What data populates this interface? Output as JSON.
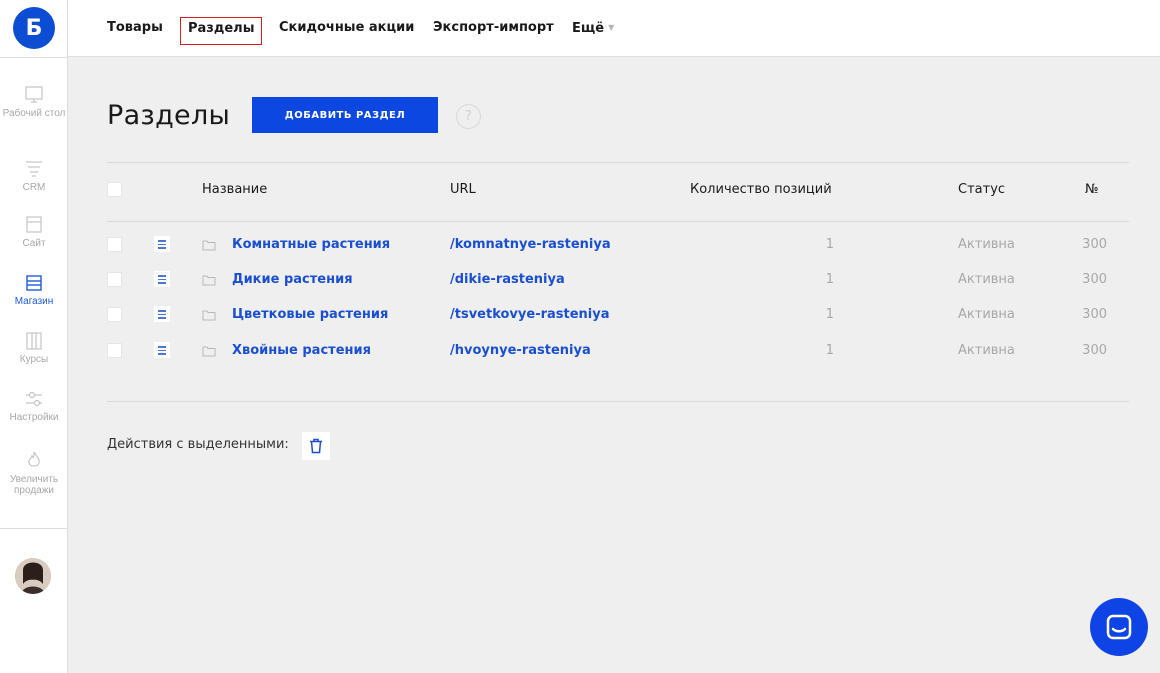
{
  "brand": {
    "logo_letter": "Б"
  },
  "sidebar": {
    "items": [
      {
        "label": "Рабочий стол",
        "icon": "monitor-icon"
      },
      {
        "label": "CRM",
        "icon": "funnel-icon"
      },
      {
        "label": "Сайт",
        "icon": "site-icon"
      },
      {
        "label": "Магазин",
        "icon": "store-icon",
        "active": true
      },
      {
        "label": "Курсы",
        "icon": "courses-icon"
      },
      {
        "label": "Настройки",
        "icon": "sliders-icon"
      },
      {
        "label": "Увеличить продажи",
        "icon": "flame-icon"
      }
    ]
  },
  "topnav": {
    "items": [
      "Товары",
      "Разделы",
      "Скидочные акции",
      "Экспорт-импорт",
      "Ещё"
    ],
    "active": "Разделы"
  },
  "page": {
    "title": "Разделы",
    "add_button": "Добавить раздел",
    "help": "?"
  },
  "table": {
    "headers": {
      "name": "Название",
      "url": "URL",
      "count": "Количество позиций",
      "status": "Статус",
      "num": "№"
    },
    "rows": [
      {
        "name": "Комнатные растения",
        "url": "/komnatnye-rasteniya",
        "count": "1",
        "status": "Активна",
        "num": "300"
      },
      {
        "name": "Дикие растения",
        "url": "/dikie-rasteniya",
        "count": "1",
        "status": "Активна",
        "num": "300"
      },
      {
        "name": "Цветковые растения",
        "url": "/tsvetkovye-rasteniya",
        "count": "1",
        "status": "Активна",
        "num": "300"
      },
      {
        "name": "Хвойные растения",
        "url": "/hvoynye-rasteniya",
        "count": "1",
        "status": "Активна",
        "num": "300"
      }
    ]
  },
  "bulk": {
    "label": "Действия с выделенными:"
  },
  "colors": {
    "accent": "#0b47e0",
    "link": "#1a4fd0",
    "active_tab_border": "#d81f1f",
    "muted": "#a8a8a8",
    "background": "#efefef"
  }
}
